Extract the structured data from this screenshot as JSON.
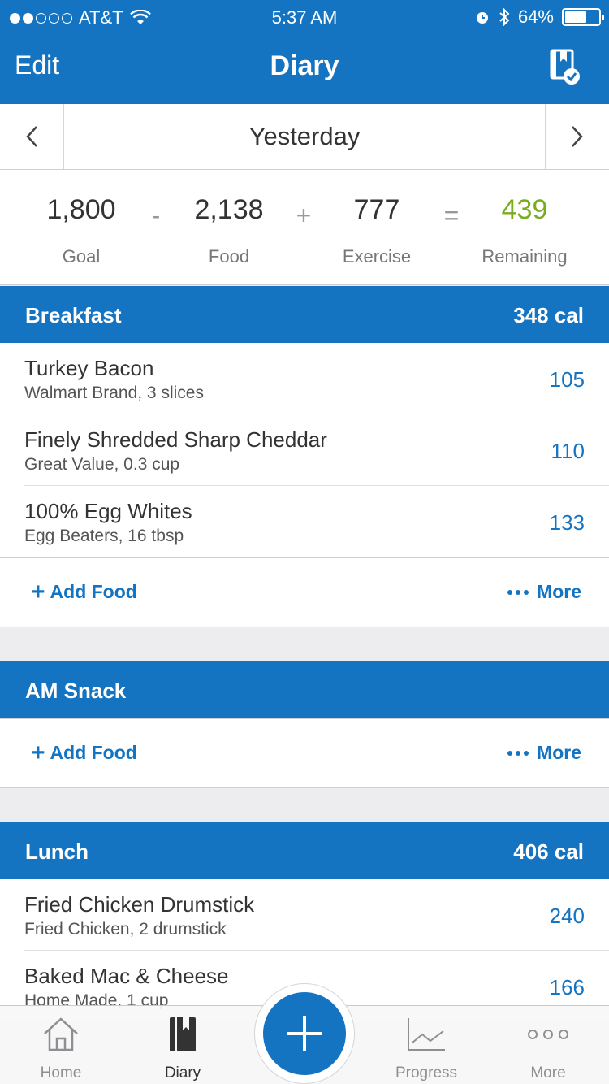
{
  "status": {
    "carrier": "AT&T",
    "time": "5:37 AM",
    "battery": "64%",
    "battery_level": 0.64
  },
  "nav": {
    "edit": "Edit",
    "title": "Diary"
  },
  "date": {
    "label": "Yesterday"
  },
  "summary": {
    "goal": {
      "value": "1,800",
      "label": "Goal"
    },
    "food": {
      "value": "2,138",
      "label": "Food"
    },
    "exercise": {
      "value": "777",
      "label": "Exercise"
    },
    "remaining": {
      "value": "439",
      "label": "Remaining"
    },
    "ops": [
      "-",
      "+",
      "="
    ]
  },
  "meals": {
    "breakfast": {
      "name": "Breakfast",
      "cal": "348 cal",
      "items": [
        {
          "name": "Turkey Bacon",
          "desc": "Walmart Brand, 3 slices",
          "cal": "105"
        },
        {
          "name": "Finely Shredded Sharp Cheddar",
          "desc": "Great Value, 0.3 cup",
          "cal": "110"
        },
        {
          "name": "100% Egg Whites",
          "desc": "Egg Beaters, 16 tbsp",
          "cal": "133"
        }
      ]
    },
    "am_snack": {
      "name": "AM Snack"
    },
    "lunch": {
      "name": "Lunch",
      "cal": "406 cal",
      "items": [
        {
          "name": "Fried Chicken Drumstick",
          "desc": "Fried Chicken, 2 drumstick",
          "cal": "240"
        },
        {
          "name": "Baked Mac & Cheese",
          "desc": "Home Made, 1 cup",
          "cal": "166"
        }
      ]
    }
  },
  "actions": {
    "add_food": "Add Food",
    "more": "More"
  },
  "tabs": [
    {
      "label": "Home",
      "icon": "home-icon"
    },
    {
      "label": "Diary",
      "icon": "diary-icon"
    },
    {
      "label": "Progress",
      "icon": "progress-chart-icon"
    },
    {
      "label": "More",
      "icon": "more-dots-icon"
    }
  ],
  "colors": {
    "brand": "#1474c1",
    "remaining": "#7aad1d"
  }
}
